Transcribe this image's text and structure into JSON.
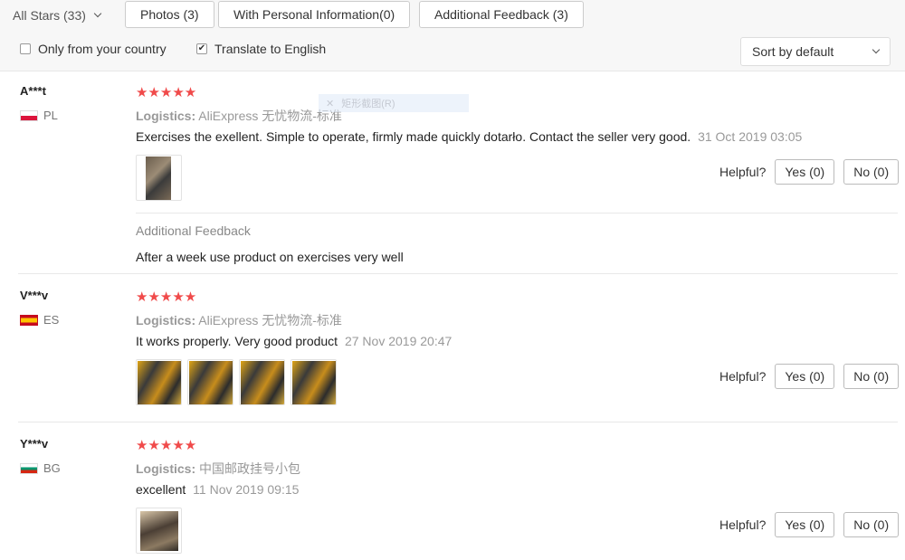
{
  "filters": {
    "rating_select": "All Stars (33)",
    "tabs": [
      "Photos (3)",
      "With Personal Information(0)",
      "Additional Feedback (3)"
    ],
    "only_country_label": "Only from your country",
    "only_country_checked": false,
    "translate_label": "Translate to English",
    "translate_checked": true,
    "sort_label": "Sort by default"
  },
  "overlay_text": "矩形截图(R)",
  "reviews": [
    {
      "user": "A***t",
      "country": "PL",
      "stars": "★★★★★",
      "logistics_label": "Logistics:",
      "logistics_value": "AliExpress 无忧物流-标准",
      "text": "Exercises the exellent. Simple to operate, firmly made quickly dotarło. Contact the seller very good.",
      "date": "31 Oct 2019 03:05",
      "helpful_label": "Helpful?",
      "yes_label": "Yes (0)",
      "no_label": "No (0)",
      "additional_title": "Additional Feedback",
      "additional_text": "After a week use product on exercises very well"
    },
    {
      "user": "V***v",
      "country": "ES",
      "stars": "★★★★★",
      "logistics_label": "Logistics:",
      "logistics_value": "AliExpress 无忧物流-标准",
      "text": "It works properly. Very good product",
      "date": "27 Nov 2019 20:47",
      "helpful_label": "Helpful?",
      "yes_label": "Yes (0)",
      "no_label": "No (0)"
    },
    {
      "user": "Y***v",
      "country": "BG",
      "stars": "★★★★★",
      "logistics_label": "Logistics:",
      "logistics_value": "中国邮政挂号小包",
      "text": "excellent",
      "date": "11 Nov 2019 09:15",
      "helpful_label": "Helpful?",
      "yes_label": "Yes (0)",
      "no_label": "No (0)"
    }
  ]
}
